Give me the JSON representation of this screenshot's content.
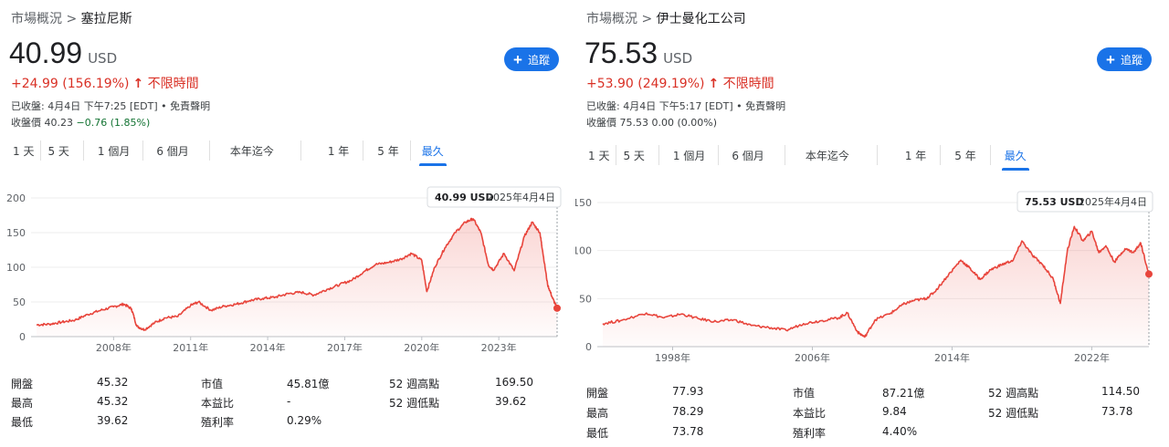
{
  "panels": [
    {
      "breadcrumb": {
        "root": "市場概況",
        "sep": ">",
        "current": "塞拉尼斯"
      },
      "price": "40.99",
      "currency": "USD",
      "change": "+24.99 (156.19%)",
      "change_arrow": "↑",
      "change_period": "不限時間",
      "closing_info": "已收盤: 4月4日 下午7:25 [EDT] • 免責聲明",
      "postclose_label": "收盤價 40.23",
      "postclose_change": "−0.76 (1.85%)",
      "follow_label": "追蹤",
      "tabs": [
        "1 天",
        "5 天",
        "1 個月",
        "6 個月",
        "本年迄今",
        "1 年",
        "5 年",
        "最久"
      ],
      "active_tab": 7,
      "tooltip": {
        "value": "40.99 USD",
        "date": "2025年4月4日"
      },
      "stats": [
        {
          "label": "開盤",
          "value": "45.32"
        },
        {
          "label": "最高",
          "value": "45.32"
        },
        {
          "label": "最低",
          "value": "39.62"
        },
        {
          "label": "市值",
          "value": "45.81億"
        },
        {
          "label": "本益比",
          "value": "-"
        },
        {
          "label": "殖利率",
          "value": "0.29%"
        },
        {
          "label": "52 週高點",
          "value": "169.50"
        },
        {
          "label": "52 週低點",
          "value": "39.62"
        }
      ]
    },
    {
      "breadcrumb": {
        "root": "市場概況",
        "sep": ">",
        "current": "伊士曼化工公司"
      },
      "price": "75.53",
      "currency": "USD",
      "change": "+53.90 (249.19%)",
      "change_arrow": "↑",
      "change_period": "不限時間",
      "closing_info": "已收盤: 4月4日 下午5:17 [EDT] • 免責聲明",
      "postclose_label": "收盤價 75.53",
      "postclose_change": "0.00 (0.00%)",
      "follow_label": "追蹤",
      "tabs": [
        "1 天",
        "5 天",
        "1 個月",
        "6 個月",
        "本年迄今",
        "1 年",
        "5 年",
        "最久"
      ],
      "active_tab": 7,
      "tooltip": {
        "value": "75.53 USD",
        "date": "2025年4月4日"
      },
      "stats": [
        {
          "label": "開盤",
          "value": "77.93"
        },
        {
          "label": "最高",
          "value": "78.29"
        },
        {
          "label": "最低",
          "value": "73.78"
        },
        {
          "label": "市值",
          "value": "87.21億"
        },
        {
          "label": "本益比",
          "value": "9.84"
        },
        {
          "label": "殖利率",
          "value": "4.40%"
        },
        {
          "label": "52 週高點",
          "value": "114.50"
        },
        {
          "label": "52 週低點",
          "value": "73.78"
        }
      ]
    }
  ],
  "colors": {
    "line": "#e8453c",
    "accent": "#1a73e8",
    "up": "#d93025",
    "down": "#137333"
  },
  "chart_data": [
    {
      "type": "area",
      "title": "",
      "xlabel": "",
      "ylabel": "",
      "x_ticks": [
        "2008年",
        "2011年",
        "2014年",
        "2017年",
        "2020年",
        "2023年"
      ],
      "x_tick_years": [
        2008,
        2011,
        2014,
        2017,
        2020,
        2023
      ],
      "x_range": [
        2005.0,
        2025.27
      ],
      "y_ticks": [
        0,
        50,
        100,
        150,
        200
      ],
      "ylim": [
        0,
        200
      ],
      "grid": true,
      "series": [
        {
          "x": [
            2005.0,
            2005.5,
            2006.0,
            2006.5,
            2007.0,
            2007.5,
            2008.0,
            2008.4,
            2008.7,
            2008.9,
            2009.2,
            2009.6,
            2010.0,
            2010.5,
            2011.0,
            2011.3,
            2011.8,
            2012.3,
            2012.8,
            2013.3,
            2013.8,
            2014.3,
            2014.8,
            2015.3,
            2015.8,
            2016.3,
            2016.8,
            2017.3,
            2017.8,
            2018.2,
            2018.7,
            2019.2,
            2019.6,
            2020.0,
            2020.2,
            2020.5,
            2020.9,
            2021.3,
            2021.7,
            2022.0,
            2022.3,
            2022.6,
            2022.8,
            2023.2,
            2023.6,
            2024.0,
            2024.3,
            2024.6,
            2024.7,
            2024.9,
            2025.1,
            2025.27
          ],
          "y": [
            17,
            18,
            21,
            24,
            32,
            38,
            43,
            47,
            40,
            15,
            10,
            20,
            27,
            29,
            45,
            50,
            38,
            44,
            47,
            52,
            55,
            57,
            62,
            64,
            60,
            68,
            75,
            82,
            95,
            104,
            107,
            112,
            120,
            110,
            65,
            100,
            128,
            150,
            165,
            170,
            150,
            103,
            96,
            120,
            95,
            145,
            165,
            150,
            125,
            75,
            55,
            40.99
          ]
        }
      ]
    },
    {
      "type": "area",
      "title": "",
      "xlabel": "",
      "ylabel": "",
      "x_ticks": [
        "1998年",
        "2006年",
        "2014年",
        "2022年"
      ],
      "x_tick_years": [
        1998,
        2006,
        2014,
        2022
      ],
      "x_range": [
        1994.0,
        2025.27
      ],
      "y_ticks": [
        0,
        50,
        100,
        150
      ],
      "ylim": [
        0,
        150
      ],
      "grid": true,
      "series": [
        {
          "x": [
            1994.0,
            1995.0,
            1996.5,
            1997.5,
            1998.5,
            1999.5,
            2000.5,
            2001.5,
            2002.5,
            2003.5,
            2004.5,
            2005.5,
            2006.5,
            2007.5,
            2008.0,
            2008.6,
            2009.0,
            2009.6,
            2010.5,
            2011.2,
            2011.8,
            2012.5,
            2013.0,
            2013.8,
            2014.5,
            2015.0,
            2015.6,
            2016.2,
            2016.8,
            2017.5,
            2018.0,
            2018.6,
            2019.2,
            2019.8,
            2020.2,
            2020.6,
            2021.0,
            2021.5,
            2022.0,
            2022.4,
            2022.8,
            2023.3,
            2023.9,
            2024.4,
            2024.8,
            2025.27
          ],
          "y": [
            24,
            27,
            35,
            30,
            34,
            29,
            26,
            28,
            22,
            20,
            17,
            24,
            27,
            30,
            35,
            15,
            10,
            28,
            35,
            44,
            48,
            50,
            57,
            75,
            90,
            82,
            70,
            80,
            85,
            90,
            110,
            95,
            85,
            70,
            45,
            100,
            125,
            110,
            120,
            98,
            105,
            88,
            102,
            98,
            108,
            75.53
          ]
        }
      ]
    }
  ]
}
